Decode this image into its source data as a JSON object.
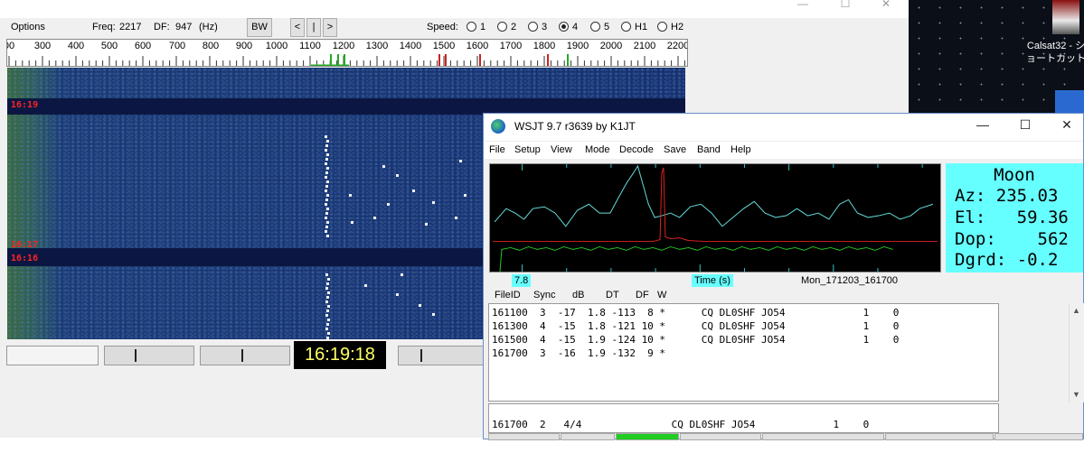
{
  "waterfall": {
    "window_controls": [
      "—",
      "☐",
      "✕"
    ],
    "options_label": "Options",
    "freq_label": "Freq:",
    "freq_value": "2217",
    "df_label": "DF:",
    "df_value": "947",
    "df_unit": "(Hz)",
    "bw_label": "BW",
    "nav_left": "<",
    "nav_mid": "|",
    "nav_right": ">",
    "speed_label": "Speed:",
    "speed_options": [
      "1",
      "2",
      "3",
      "4",
      "5",
      "H1",
      "H2"
    ],
    "speed_selected": "4",
    "scale_labels": [
      "00",
      "300",
      "400",
      "500",
      "600",
      "700",
      "800",
      "900",
      "1000",
      "1100",
      "1200",
      "1300",
      "1400",
      "1500",
      "1600",
      "1700",
      "1800",
      "1900",
      "2000",
      "2100",
      "2200"
    ],
    "time_marks": [
      "16:19",
      "16:17",
      "16:16"
    ],
    "clock": "16:19:18"
  },
  "desktop": {
    "icon_label": "Calsat32 - シ ョートカット"
  },
  "wsjt": {
    "title": "WSJT 9.7   r3639    by K1JT",
    "window_controls": [
      "—",
      "☐",
      "✕"
    ],
    "menu": [
      "File",
      "Setup",
      "View",
      "Mode",
      "Decode",
      "Save",
      "Band",
      "Help"
    ],
    "moon": {
      "title": "Moon",
      "az": "Az: 235.03",
      "el": "El:   59.36",
      "dop": "Dop:    562",
      "dgrd": "Dgrd: -0.2"
    },
    "under_spectrum": {
      "left_value": "7.8",
      "time_label": "Time (s)",
      "file_label": "Mon_171203_161700"
    },
    "columns": [
      "FileID",
      "Sync",
      "dB",
      "DT",
      "DF",
      "W"
    ],
    "decodes": [
      "161100  3  -17  1.8 -113  8 *      CQ DL0SHF JO54             1    0",
      "161300  4  -15  1.8 -121 10 *      CQ DL0SHF JO54             1    0",
      "161500  4  -15  1.9 -124 10 *      CQ DL0SHF JO54             1    0",
      "161700  3  -16  1.9 -132  9 *"
    ],
    "average": "161700  2   4/4               CQ DL0SHF JO54             1    0",
    "scroll_up": "▲",
    "scroll_down": "▼"
  }
}
